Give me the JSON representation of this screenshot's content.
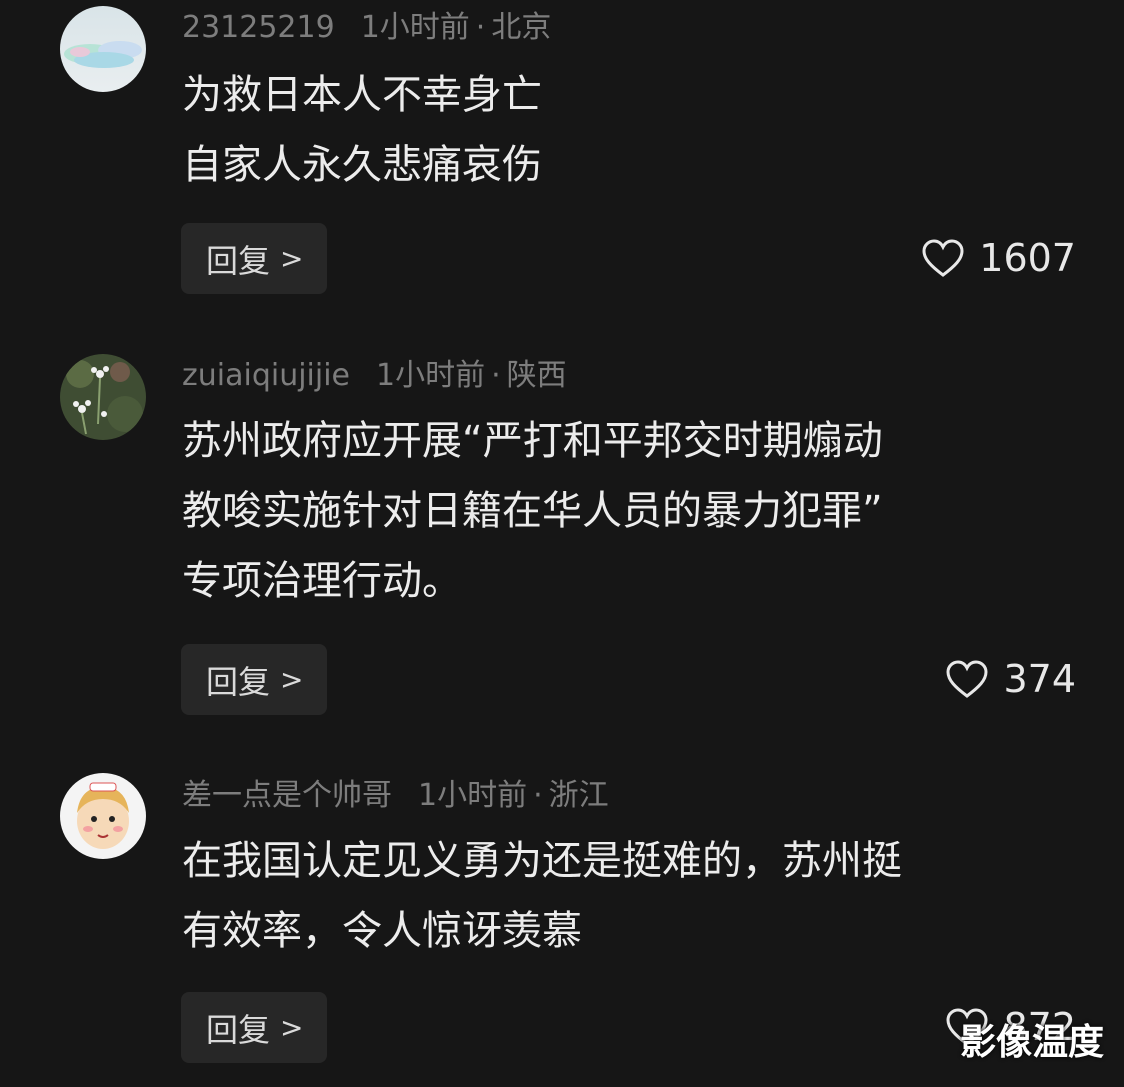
{
  "comments": [
    {
      "username": "23125219",
      "time": "1小时前",
      "separator": "·",
      "location": "北京",
      "lines": [
        "为救日本人不幸身亡",
        "自家人永久悲痛哀伤"
      ],
      "reply_label": "回复",
      "reply_chevron": ">",
      "likes": "1607",
      "avatar_icon": "sky-avatar-icon"
    },
    {
      "username": "zuiaiqiujijie",
      "time": "1小时前",
      "separator": "·",
      "location": "陕西",
      "lines": [
        "苏州政府应开展“严打和平邦交时期煽动",
        "教唆实施针对日籍在华人员的暴力犯罪”",
        "专项治理行动。"
      ],
      "reply_label": "回复",
      "reply_chevron": ">",
      "likes": "374",
      "avatar_icon": "flower-avatar-icon"
    },
    {
      "username": "差一点是个帅哥",
      "time": "1小时前",
      "separator": "·",
      "location": "浙江",
      "lines": [
        "在我国认定见义勇为还是挺难的，苏州挺",
        "有效率，令人惊讶羡慕"
      ],
      "reply_label": "回复",
      "reply_chevron": ">",
      "likes": "872",
      "avatar_icon": "cartoon-boy-avatar-icon"
    }
  ],
  "watermark": "影像温度",
  "colors": {
    "background": "#161616",
    "meta_text": "#7d7d7d",
    "body_text": "#ececec",
    "reply_button": "#272727"
  }
}
